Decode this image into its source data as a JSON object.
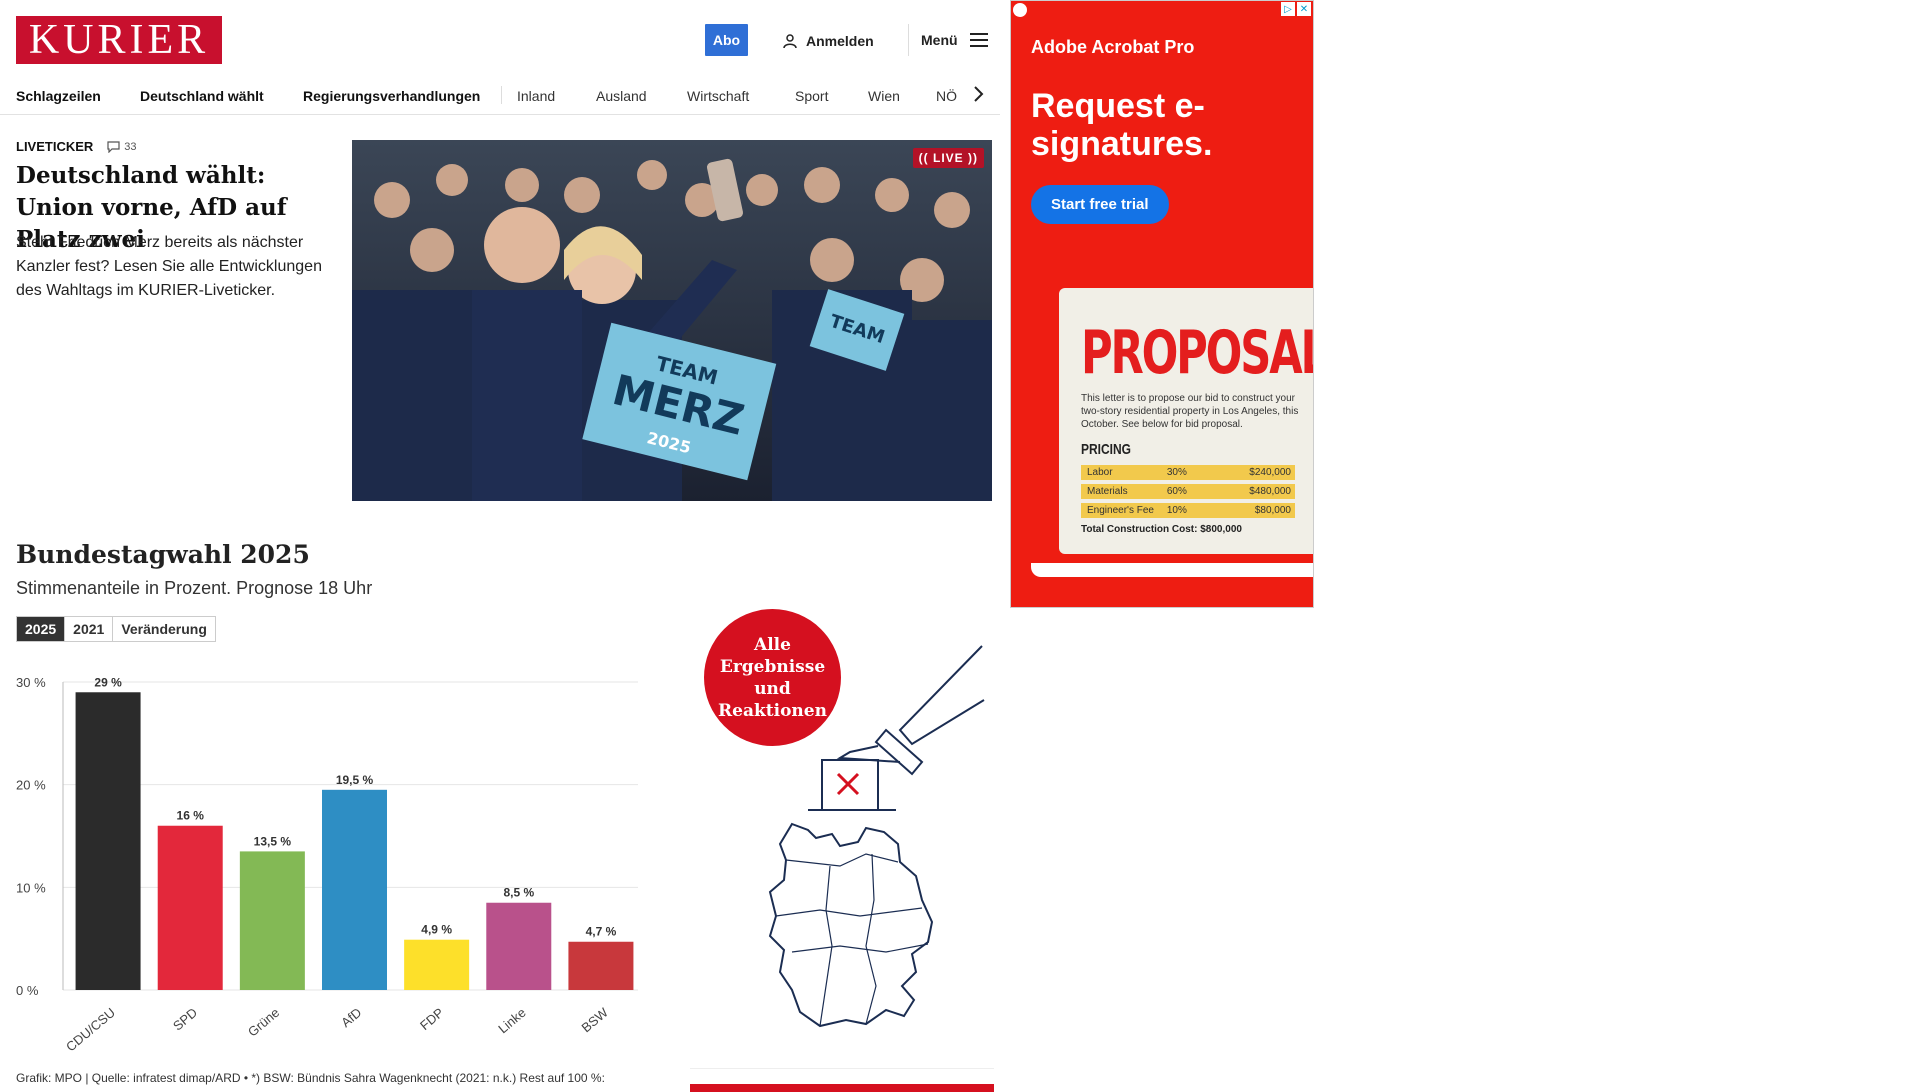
{
  "header": {
    "logo": "KURIER",
    "abo_label": "Abo",
    "login_label": "Anmelden",
    "menu_label": "Menü"
  },
  "nav": {
    "items": [
      "Schlagzeilen",
      "Deutschland wählt",
      "Regierungsverhandlungen",
      "Inland",
      "Ausland",
      "Wirtschaft",
      "Sport",
      "Wien",
      "NÖ"
    ]
  },
  "teaser": {
    "kicker": "LIVETICKER",
    "comment_count": "33",
    "headline": "Deutschland wählt: Union vorne, AfD auf Platz zwei",
    "text": "Steht Friedrich Merz bereits als nächster Kanzler fest? Lesen Sie alle Entwicklungen des Wahltags im KURIER-Liveticker.",
    "live_badge": "LIVE",
    "sign_text": "TEAM MERZ 2025"
  },
  "election": {
    "title": "Bundestagwahl 2025",
    "subtitle": "Stimmenanteile in Prozent. Prognose 18 Uhr",
    "tabs": [
      "2025",
      "2021",
      "Veränderung"
    ],
    "active_tab": "2025",
    "footnote": "Grafik: MPO | Quelle: infratest dimap/ARD • *) BSW: Bündnis Sahra Wagenknecht (2021: n.k.) Rest auf 100 %:",
    "results_button": "Alle Ergebnisse und Reaktionen"
  },
  "chart_data": {
    "type": "bar",
    "categories": [
      "CDU/CSU",
      "SPD",
      "Grüne",
      "AfD",
      "FDP",
      "Linke",
      "BSW"
    ],
    "values": [
      29,
      16,
      13.5,
      19.5,
      4.9,
      8.5,
      4.7
    ],
    "value_labels": [
      "29 %",
      "16 %",
      "13,5 %",
      "19,5 %",
      "4,9 %",
      "8,5 %",
      "4,7 %"
    ],
    "colors": [
      "#2b2b2b",
      "#e3283b",
      "#83b955",
      "#2e8ec4",
      "#fde02a",
      "#b9518b",
      "#c8383c"
    ],
    "yticks": [
      "0 %",
      "10 %",
      "20 %",
      "30 %"
    ],
    "ylim": [
      0,
      30
    ],
    "grid": true
  },
  "ad": {
    "brand": "Adobe Acrobat Pro",
    "headline": "Request e-signatures.",
    "cta": "Start free trial",
    "paper_title": "PROPOSAL",
    "paper_text": "This letter is to propose our bid to construct your two-story residential property in Los Angeles, this October. See below for bid proposal.",
    "pricing_label": "PRICING",
    "pricing_rows": [
      [
        "Labor",
        "30%",
        "$240,000"
      ],
      [
        "Materials",
        "60%",
        "$480,000"
      ],
      [
        "Engineer's Fee",
        "10%",
        "$80,000"
      ]
    ],
    "total": "Total Construction Cost: $800,000"
  },
  "colors": {
    "brand_red": "#c8102e",
    "abo_blue": "#2f6fd6",
    "ad_red": "#ee1d12",
    "ad_blue": "#1473e6"
  }
}
